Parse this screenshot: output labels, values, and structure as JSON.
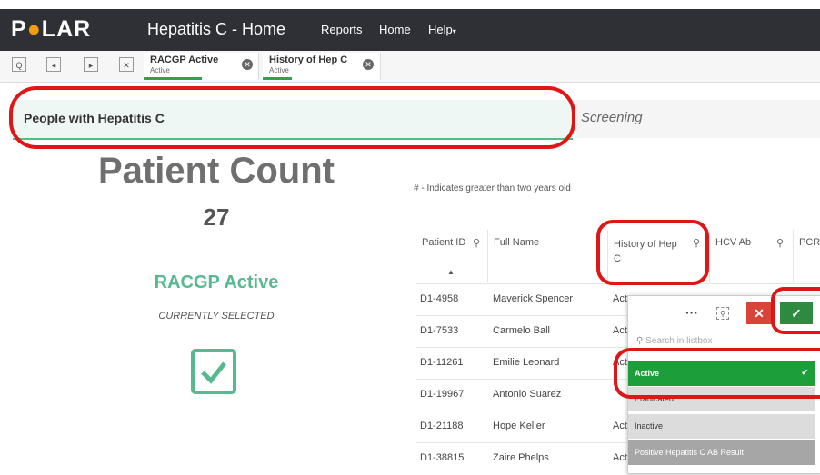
{
  "app": {
    "logo": "POLAR",
    "title": "Hepatitis C - Home",
    "nav": [
      "Reports",
      "Home",
      "Help"
    ],
    "help_caret": "▾"
  },
  "selections": {
    "tabs": [
      {
        "name": "RACGP Active",
        "state": "Active"
      },
      {
        "name": "History of Hep C",
        "state": "Active"
      }
    ]
  },
  "sheet": {
    "band_title": "People with Hepatitis C",
    "next_tab": "Screening"
  },
  "kpi": {
    "title": "Patient Count",
    "value": "27",
    "filter_label": "RACGP Active",
    "filter_state": "CURRENTLY SELECTED"
  },
  "table": {
    "note": "# - Indicates greater than two years old",
    "columns": [
      "Patient ID",
      "Full Name",
      "History of Hep C",
      "HCV Ab",
      "PCR"
    ],
    "rows": [
      {
        "id": "D1-4958",
        "name": "Maverick Spencer",
        "hist": "Act"
      },
      {
        "id": "D1-7533",
        "name": "Carmelo Ball",
        "hist": "Act"
      },
      {
        "id": "D1-11261",
        "name": "Emilie Leonard",
        "hist": "Act"
      },
      {
        "id": "D1-19967",
        "name": "Antonio Suarez",
        "hist": ""
      },
      {
        "id": "D1-21188",
        "name": "Hope Keller",
        "hist": "Act"
      },
      {
        "id": "D1-38815",
        "name": "Zaire Phelps",
        "hist": "Act"
      }
    ]
  },
  "listbox": {
    "more": "···",
    "search_placeholder": "Search in listbox",
    "items": [
      {
        "label": "Active",
        "state": "selected"
      },
      {
        "label": "Eradicated",
        "state": "alternative"
      },
      {
        "label": "Inactive",
        "state": "alternative"
      },
      {
        "label": "Positive Hepatitis C AB Result",
        "state": "excluded"
      }
    ],
    "check_mark": "✔"
  },
  "colors": {
    "topbar": "#2f3035",
    "accent_green": "#57b98f",
    "selected_green": "#1c9e3b",
    "confirm_green": "#2e8a3e",
    "cancel_red": "#d9443a",
    "annotation_red": "#e01515"
  }
}
